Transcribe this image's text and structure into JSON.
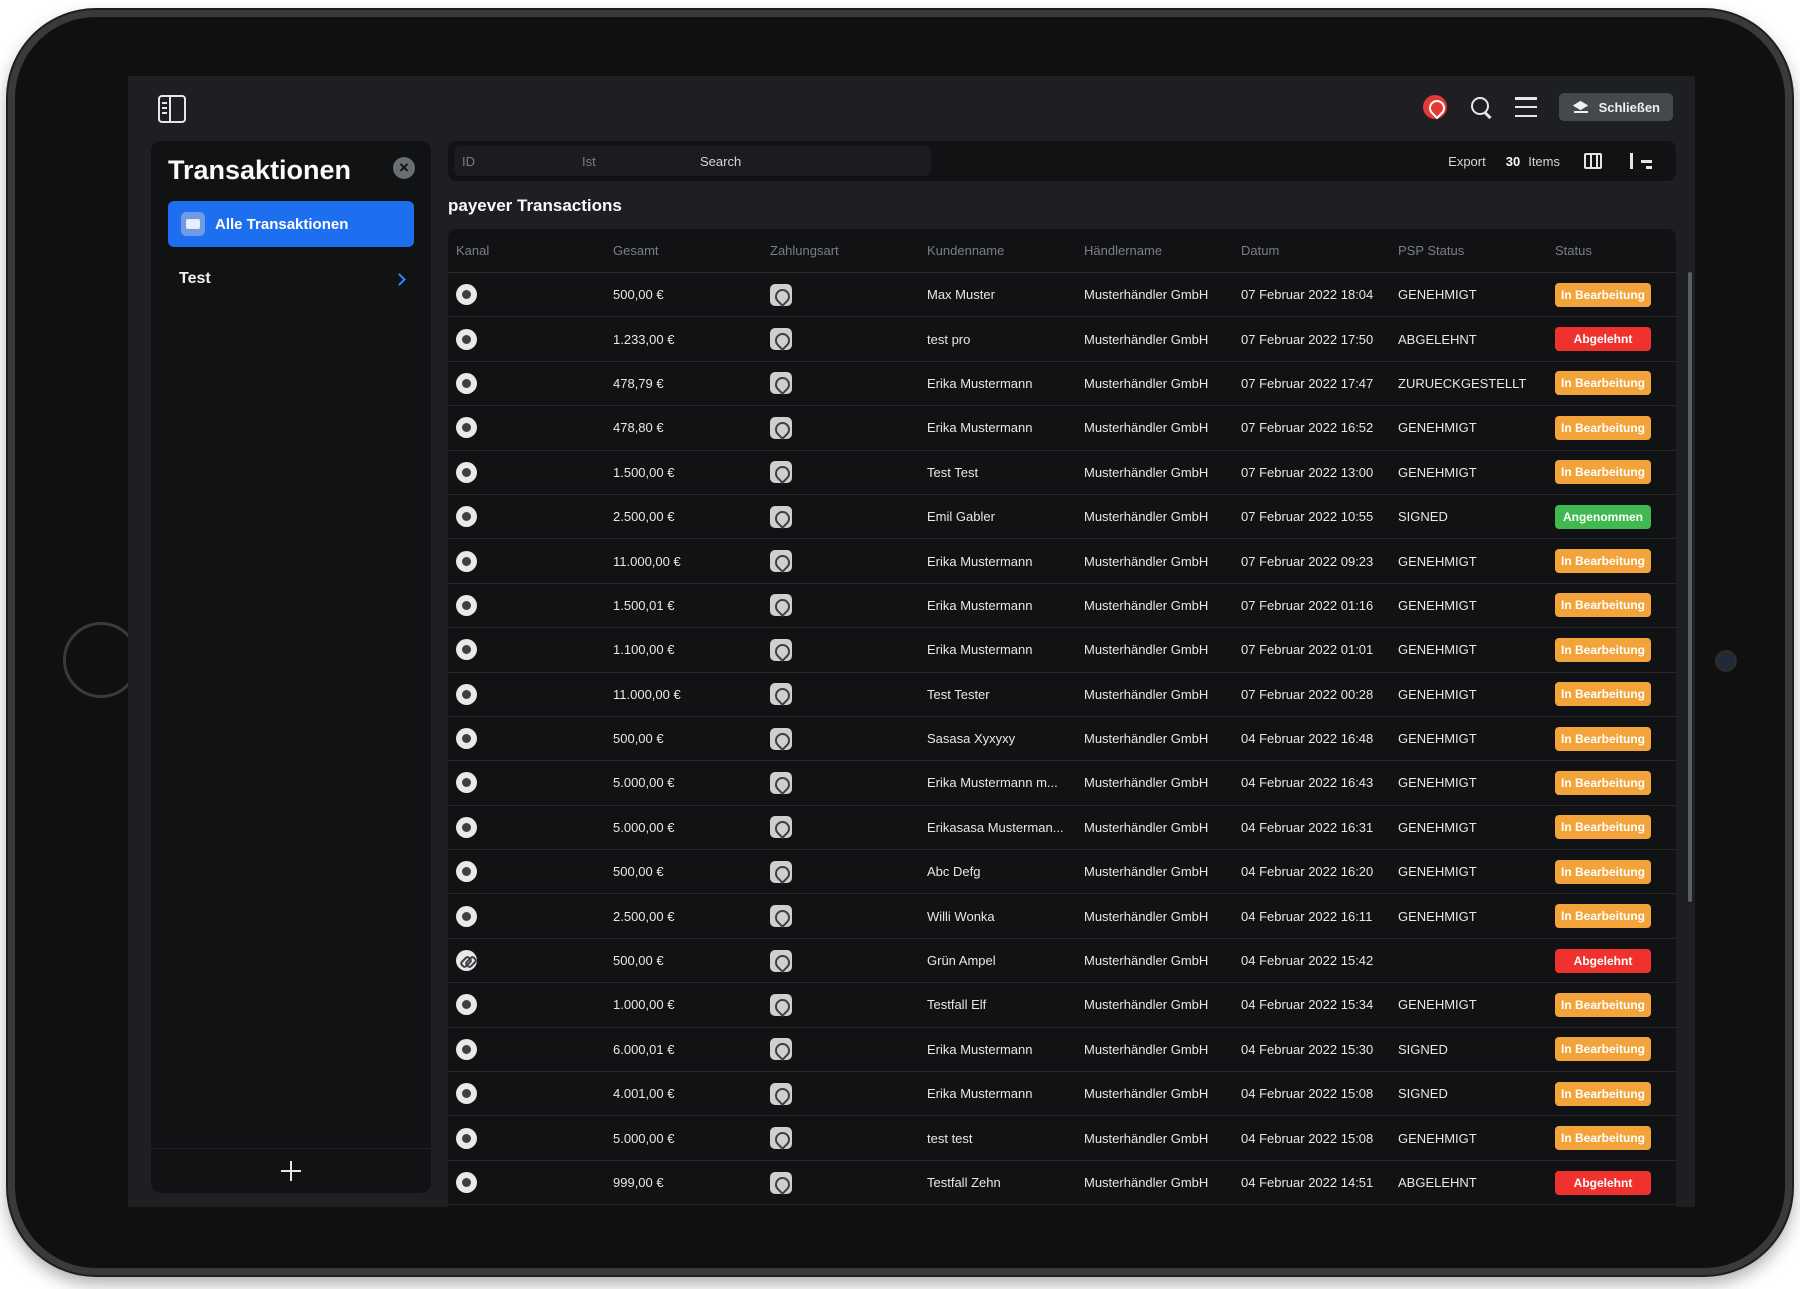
{
  "app": {
    "close_label": "Schließen"
  },
  "sidebar": {
    "title": "Transaktionen",
    "active_item": "Alle Transaktionen",
    "items": [
      {
        "label": "Test"
      }
    ]
  },
  "filters": {
    "id_placeholder": "ID",
    "ist_placeholder": "Ist",
    "search_placeholder": "Search",
    "export_label": "Export",
    "items_count": "30",
    "items_label": "Items"
  },
  "table": {
    "title": "payever Transactions",
    "headers": [
      "Kanal",
      "Gesamt",
      "Zahlungsart",
      "Kundenname",
      "Händlername",
      "Datum",
      "PSP Status",
      "Status"
    ],
    "rows": [
      {
        "kanal": "pos",
        "gesamt": "500,00 €",
        "kunde": "Max Muster",
        "haendler": "Musterhändler GmbH",
        "datum": "07 Februar 2022 18:04",
        "psp": "GENEHMIGT",
        "status": "In Bearbeitung",
        "color": "orange"
      },
      {
        "kanal": "pos",
        "gesamt": "1.233,00 €",
        "kunde": "test pro",
        "haendler": "Musterhändler GmbH",
        "datum": "07 Februar 2022 17:50",
        "psp": "ABGELEHNT",
        "status": "Abgelehnt",
        "color": "red"
      },
      {
        "kanal": "pos",
        "gesamt": "478,79 €",
        "kunde": "Erika Mustermann",
        "haendler": "Musterhändler GmbH",
        "datum": "07 Februar 2022 17:47",
        "psp": "ZURUECKGESTELLT",
        "status": "In Bearbeitung",
        "color": "orange"
      },
      {
        "kanal": "pos",
        "gesamt": "478,80 €",
        "kunde": "Erika Mustermann",
        "haendler": "Musterhändler GmbH",
        "datum": "07 Februar 2022 16:52",
        "psp": "GENEHMIGT",
        "status": "In Bearbeitung",
        "color": "orange"
      },
      {
        "kanal": "pos",
        "gesamt": "1.500,00 €",
        "kunde": "Test Test",
        "haendler": "Musterhändler GmbH",
        "datum": "07 Februar 2022 13:00",
        "psp": "GENEHMIGT",
        "status": "In Bearbeitung",
        "color": "orange"
      },
      {
        "kanal": "pos",
        "gesamt": "2.500,00 €",
        "kunde": "Emil Gabler",
        "haendler": "Musterhändler GmbH",
        "datum": "07 Februar 2022 10:55",
        "psp": "SIGNED",
        "status": "Angenommen",
        "color": "green"
      },
      {
        "kanal": "pos",
        "gesamt": "11.000,00 €",
        "kunde": "Erika Mustermann",
        "haendler": "Musterhändler GmbH",
        "datum": "07 Februar 2022 09:23",
        "psp": "GENEHMIGT",
        "status": "In Bearbeitung",
        "color": "orange"
      },
      {
        "kanal": "pos",
        "gesamt": "1.500,01 €",
        "kunde": "Erika Mustermann",
        "haendler": "Musterhändler GmbH",
        "datum": "07 Februar 2022 01:16",
        "psp": "GENEHMIGT",
        "status": "In Bearbeitung",
        "color": "orange"
      },
      {
        "kanal": "pos",
        "gesamt": "1.100,00 €",
        "kunde": "Erika Mustermann",
        "haendler": "Musterhändler GmbH",
        "datum": "07 Februar 2022 01:01",
        "psp": "GENEHMIGT",
        "status": "In Bearbeitung",
        "color": "orange"
      },
      {
        "kanal": "pos",
        "gesamt": "11.000,00 €",
        "kunde": "Test Tester",
        "haendler": "Musterhändler GmbH",
        "datum": "07 Februar 2022 00:28",
        "psp": "GENEHMIGT",
        "status": "In Bearbeitung",
        "color": "orange"
      },
      {
        "kanal": "pos",
        "gesamt": "500,00 €",
        "kunde": "Sasasa Xyxyxy",
        "haendler": "Musterhändler GmbH",
        "datum": "04 Februar 2022 16:48",
        "psp": "GENEHMIGT",
        "status": "In Bearbeitung",
        "color": "orange"
      },
      {
        "kanal": "pos",
        "gesamt": "5.000,00 €",
        "kunde": "Erika Mustermann m...",
        "haendler": "Musterhändler GmbH",
        "datum": "04 Februar 2022 16:43",
        "psp": "GENEHMIGT",
        "status": "In Bearbeitung",
        "color": "orange"
      },
      {
        "kanal": "pos",
        "gesamt": "5.000,00 €",
        "kunde": "Erikasasa Musterman...",
        "haendler": "Musterhändler GmbH",
        "datum": "04 Februar 2022 16:31",
        "psp": "GENEHMIGT",
        "status": "In Bearbeitung",
        "color": "orange"
      },
      {
        "kanal": "pos",
        "gesamt": "500,00 €",
        "kunde": "Abc Defg",
        "haendler": "Musterhändler GmbH",
        "datum": "04 Februar 2022 16:20",
        "psp": "GENEHMIGT",
        "status": "In Bearbeitung",
        "color": "orange"
      },
      {
        "kanal": "pos",
        "gesamt": "2.500,00 €",
        "kunde": "Willi Wonka",
        "haendler": "Musterhändler GmbH",
        "datum": "04 Februar 2022 16:11",
        "psp": "GENEHMIGT",
        "status": "In Bearbeitung",
        "color": "orange"
      },
      {
        "kanal": "link",
        "gesamt": "500,00 €",
        "kunde": "Grün Ampel",
        "haendler": "Musterhändler GmbH",
        "datum": "04 Februar 2022 15:42",
        "psp": "",
        "status": "Abgelehnt",
        "color": "red"
      },
      {
        "kanal": "pos",
        "gesamt": "1.000,00 €",
        "kunde": "Testfall Elf",
        "haendler": "Musterhändler GmbH",
        "datum": "04 Februar 2022 15:34",
        "psp": "GENEHMIGT",
        "status": "In Bearbeitung",
        "color": "orange"
      },
      {
        "kanal": "pos",
        "gesamt": "6.000,01 €",
        "kunde": "Erika Mustermann",
        "haendler": "Musterhändler GmbH",
        "datum": "04 Februar 2022 15:30",
        "psp": "SIGNED",
        "status": "In Bearbeitung",
        "color": "orange"
      },
      {
        "kanal": "pos",
        "gesamt": "4.001,00 €",
        "kunde": "Erika Mustermann",
        "haendler": "Musterhändler GmbH",
        "datum": "04 Februar 2022 15:08",
        "psp": "SIGNED",
        "status": "In Bearbeitung",
        "color": "orange"
      },
      {
        "kanal": "pos",
        "gesamt": "5.000,00 €",
        "kunde": "test test",
        "haendler": "Musterhändler GmbH",
        "datum": "04 Februar 2022 15:08",
        "psp": "GENEHMIGT",
        "status": "In Bearbeitung",
        "color": "orange"
      },
      {
        "kanal": "pos",
        "gesamt": "999,00 €",
        "kunde": "Testfall Zehn",
        "haendler": "Musterhändler GmbH",
        "datum": "04 Februar 2022 14:51",
        "psp": "ABGELEHNT",
        "status": "Abgelehnt",
        "color": "red"
      }
    ]
  }
}
